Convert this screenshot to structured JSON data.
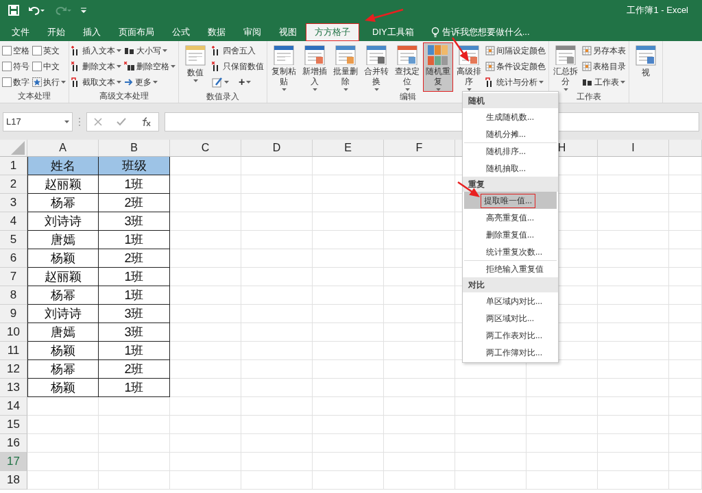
{
  "window": {
    "title": "工作簿1 - Excel"
  },
  "tabs": [
    {
      "label": "文件",
      "selected": false
    },
    {
      "label": "开始",
      "selected": false
    },
    {
      "label": "插入",
      "selected": false
    },
    {
      "label": "页面布局",
      "selected": false
    },
    {
      "label": "公式",
      "selected": false
    },
    {
      "label": "数据",
      "selected": false
    },
    {
      "label": "审阅",
      "selected": false
    },
    {
      "label": "视图",
      "selected": false
    },
    {
      "label": "方方格子",
      "selected": true
    },
    {
      "label": "DIY工具箱",
      "selected": false
    }
  ],
  "tell_me": {
    "placeholder": "告诉我您想要做什么..."
  },
  "ribbon": [
    {
      "label": "文本处理",
      "columns": [
        [
          {
            "kind": "checkbox",
            "label": "空格",
            "checked": false
          },
          {
            "kind": "checkbox",
            "label": "符号",
            "checked": false
          },
          {
            "kind": "checkbox",
            "label": "数字",
            "checked": false
          }
        ],
        [
          {
            "kind": "checkbox",
            "label": "英文",
            "checked": false
          },
          {
            "kind": "checkbox",
            "label": "中文",
            "checked": false
          },
          {
            "kind": "small",
            "label": "执行",
            "dropdown": true
          }
        ]
      ]
    },
    {
      "label": "高级文本处理",
      "columns": [
        [
          {
            "kind": "small",
            "label": "插入文本",
            "dropdown": true
          },
          {
            "kind": "small",
            "label": "删除文本",
            "dropdown": true
          },
          {
            "kind": "small",
            "label": "截取文本",
            "dropdown": true
          }
        ],
        [
          {
            "kind": "small",
            "label": "大小写",
            "dropdown": true
          },
          {
            "kind": "small",
            "label": "删除空格",
            "dropdown": true
          },
          {
            "kind": "small",
            "label": "更多",
            "dropdown": true
          }
        ]
      ]
    },
    {
      "label": "数值录入",
      "columns": [
        [
          {
            "kind": "large",
            "label": "数值",
            "dropdown": true,
            "pressed": false
          }
        ],
        [
          {
            "kind": "small",
            "label": "四舍五入",
            "dropdown": false
          },
          {
            "kind": "small",
            "label": "只保留数值",
            "dropdown": false
          },
          {
            "kind": "pair",
            "label": "+",
            "dropdown": true
          }
        ]
      ]
    },
    {
      "label": "编辑",
      "columns": [
        [
          {
            "kind": "large",
            "label": "复制粘贴",
            "dropdown": true,
            "pressed": false
          }
        ],
        [
          {
            "kind": "large",
            "label": "新增插入",
            "dropdown": true,
            "pressed": false
          }
        ],
        [
          {
            "kind": "large",
            "label": "批量删除",
            "dropdown": true,
            "pressed": false
          }
        ],
        [
          {
            "kind": "large",
            "label": "合并转换",
            "dropdown": true,
            "pressed": false
          }
        ],
        [
          {
            "kind": "large",
            "label": "查找定位",
            "dropdown": true,
            "pressed": false
          }
        ],
        [
          {
            "kind": "large",
            "label": "随机重复",
            "dropdown": true,
            "pressed": true
          }
        ],
        [
          {
            "kind": "large",
            "label": "高级排序",
            "dropdown": true,
            "pressed": false
          }
        ],
        [
          {
            "kind": "small",
            "label": "间隔设定颜色",
            "dropdown": false
          },
          {
            "kind": "small",
            "label": "条件设定颜色",
            "dropdown": false
          },
          {
            "kind": "small",
            "label": "统计与分析",
            "dropdown": true
          }
        ]
      ]
    },
    {
      "label": "工作表",
      "columns": [
        [
          {
            "kind": "large",
            "label": "汇总拆分",
            "dropdown": true,
            "pressed": false
          }
        ],
        [
          {
            "kind": "small",
            "label": "另存本表",
            "dropdown": false
          },
          {
            "kind": "small",
            "label": "表格目录",
            "dropdown": false
          },
          {
            "kind": "small",
            "label": "工作表",
            "dropdown": true
          }
        ]
      ]
    },
    {
      "columns": [
        [
          {
            "kind": "large",
            "label": "视",
            "dropdown": false,
            "pressed": false
          }
        ]
      ]
    }
  ],
  "name_box": {
    "value": "L17"
  },
  "columns": [
    "A",
    "B",
    "C",
    "D",
    "E",
    "F",
    null,
    "H",
    "I",
    null
  ],
  "rows": [
    {
      "number": "1",
      "selected": false,
      "cells": [
        "姓名",
        "班级"
      ],
      "header": true
    },
    {
      "number": "2",
      "selected": false,
      "cells": [
        "赵丽颖",
        "1班"
      ],
      "header": false
    },
    {
      "number": "3",
      "selected": false,
      "cells": [
        "杨幂",
        "2班"
      ],
      "header": false
    },
    {
      "number": "4",
      "selected": false,
      "cells": [
        "刘诗诗",
        "3班"
      ],
      "header": false
    },
    {
      "number": "5",
      "selected": false,
      "cells": [
        "唐嫣",
        "1班"
      ],
      "header": false
    },
    {
      "number": "6",
      "selected": false,
      "cells": [
        "杨颖",
        "2班"
      ],
      "header": false
    },
    {
      "number": "7",
      "selected": false,
      "cells": [
        "赵丽颖",
        "1班"
      ],
      "header": false
    },
    {
      "number": "8",
      "selected": false,
      "cells": [
        "杨幂",
        "1班"
      ],
      "header": false
    },
    {
      "number": "9",
      "selected": false,
      "cells": [
        "刘诗诗",
        "3班"
      ],
      "header": false
    },
    {
      "number": "10",
      "selected": false,
      "cells": [
        "唐嫣",
        "3班"
      ],
      "header": false
    },
    {
      "number": "11",
      "selected": false,
      "cells": [
        "杨颖",
        "1班"
      ],
      "header": false
    },
    {
      "number": "12",
      "selected": false,
      "cells": [
        "杨幂",
        "2班"
      ],
      "header": false
    },
    {
      "number": "13",
      "selected": false,
      "cells": [
        "杨颖",
        "1班"
      ],
      "header": false
    },
    {
      "number": "14",
      "selected": false,
      "cells": []
    },
    {
      "number": "15",
      "selected": false,
      "cells": []
    },
    {
      "number": "16",
      "selected": false,
      "cells": []
    },
    {
      "number": "17",
      "selected": true,
      "cells": []
    },
    {
      "number": "18",
      "selected": false,
      "cells": []
    }
  ],
  "menu": [
    {
      "heading": "随机",
      "items": [
        {
          "label": "生成随机数...",
          "selected": false,
          "divided": false
        },
        {
          "label": "随机分摊...",
          "selected": false,
          "divided": false
        },
        {
          "label": "随机排序...",
          "selected": false,
          "divided": true
        },
        {
          "label": "随机抽取...",
          "selected": false,
          "divided": false
        }
      ]
    },
    {
      "heading": "重复",
      "items": [
        {
          "label": "提取唯一值...",
          "selected": true,
          "divided": false
        },
        {
          "label": "高亮重复值...",
          "selected": false,
          "divided": false
        },
        {
          "label": "删除重复值...",
          "selected": false,
          "divided": false
        },
        {
          "label": "统计重复次数...",
          "selected": false,
          "divided": false
        },
        {
          "label": "拒绝输入重复值",
          "selected": false,
          "divided": true
        }
      ]
    },
    {
      "heading": "对比",
      "items": [
        {
          "label": "单区域内对比...",
          "selected": false,
          "divided": false
        },
        {
          "label": "两区域对比...",
          "selected": false,
          "divided": false
        },
        {
          "label": "两工作表对比...",
          "selected": false,
          "divided": false
        },
        {
          "label": "两工作簿对比...",
          "selected": false,
          "divided": false
        }
      ]
    }
  ]
}
